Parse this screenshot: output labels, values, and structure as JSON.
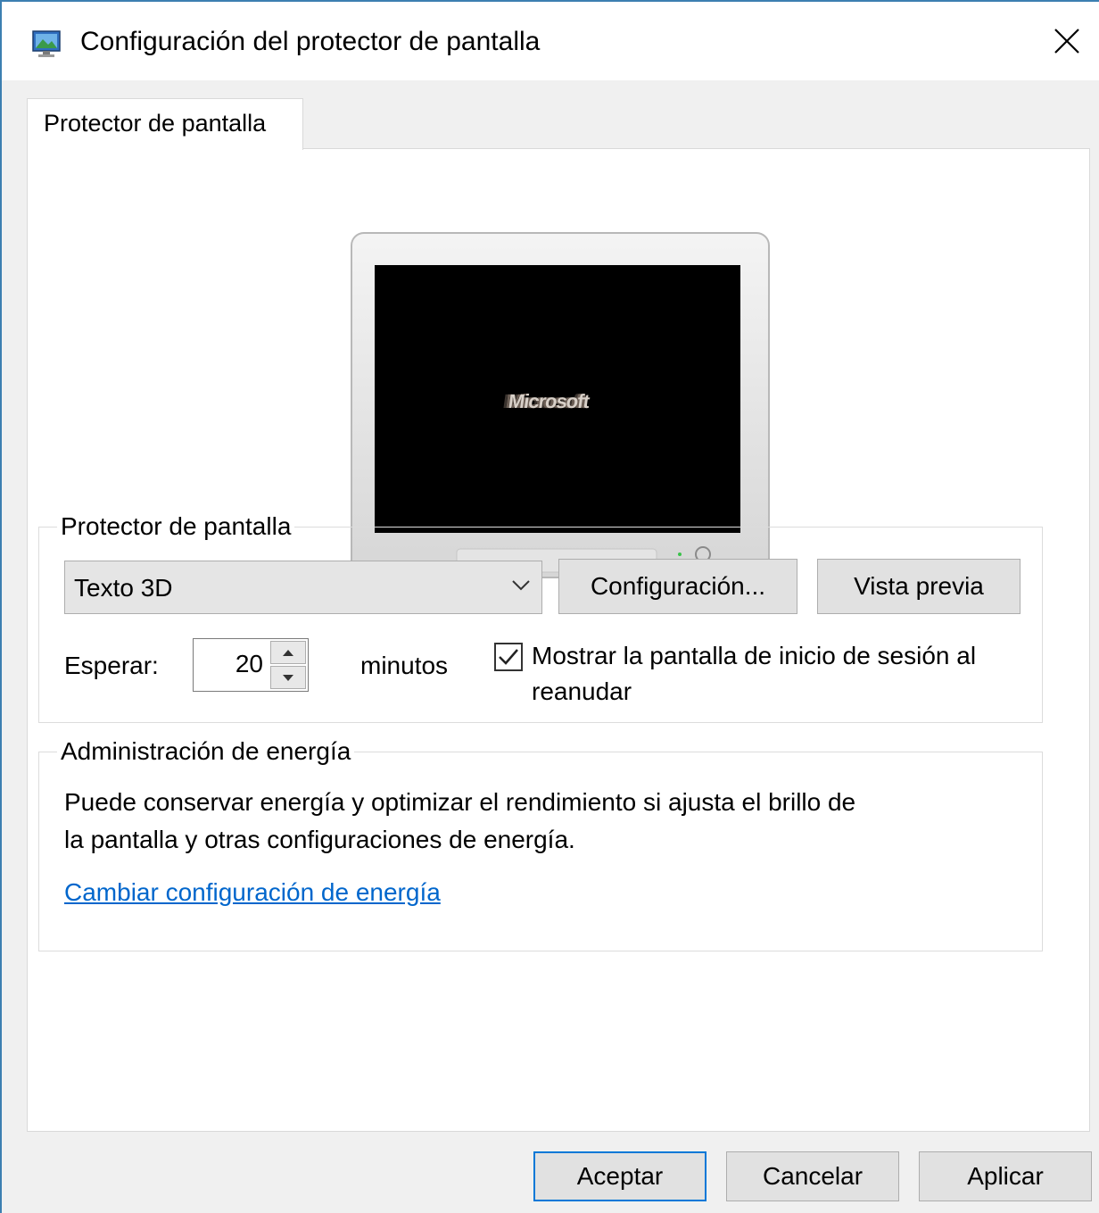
{
  "window": {
    "title": "Configuración del protector de pantalla",
    "icon": "screensaver-settings-icon",
    "close_icon": "close-icon"
  },
  "tabs": [
    {
      "label": "Protector de pantalla",
      "selected": true
    }
  ],
  "preview": {
    "screen_text": "Microsoft"
  },
  "screensaver_group": {
    "legend": "Protector de pantalla",
    "selected_screensaver": "Texto 3D",
    "settings_button": "Configuración...",
    "preview_button": "Vista previa",
    "wait_label": "Esperar:",
    "wait_value": "20",
    "minutes_label": "minutos",
    "resume_checkbox_label": "Mostrar la pantalla de inicio de sesión al reanudar",
    "resume_checked": true
  },
  "power_group": {
    "legend": "Administración de energía",
    "description": "Puede conservar energía y optimizar el rendimiento si ajusta el brillo de la pantalla y otras configuraciones de energía.",
    "link": "Cambiar configuración de energía"
  },
  "footer": {
    "ok": "Aceptar",
    "cancel": "Cancelar",
    "apply": "Aplicar"
  },
  "colors": {
    "accent": "#0078d7",
    "link": "#0066cc",
    "window_border": "#3c7fb1"
  }
}
